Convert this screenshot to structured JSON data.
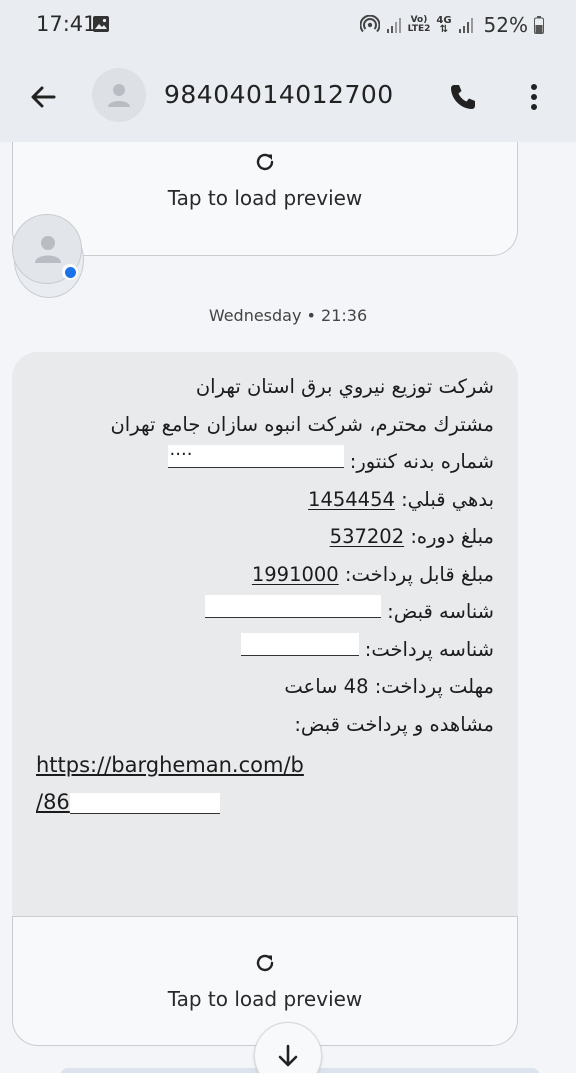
{
  "status_bar": {
    "time": "17:41",
    "network_top": "Vo)",
    "network_bottom": "LTE2",
    "network_4g": "4G",
    "battery": "52%"
  },
  "top_bar": {
    "contact_number": "98404014012700"
  },
  "preview_top": {
    "label": "Tap to load preview"
  },
  "timestamp": "Wednesday • 21:36",
  "message": {
    "line1": "شرکت توزیع نیروي برق استان تهران",
    "line2": "مشترك محترم، شرکت انبوه سازان جامع تهران",
    "meter_label": "شماره بدنه کنتور:",
    "meter_value": "....",
    "previous_debt_label": "بدهي قبلي:",
    "previous_debt_value": "1454454",
    "period_amount_label": "مبلغ دوره:",
    "period_amount_value": "537202",
    "payable_label": "مبلغ قابل پرداخت:",
    "payable_value": "1991000",
    "bill_id_label": "شناسه قبض:",
    "payment_id_label": "شناسه پرداخت:",
    "deadline_label": "مهلت پرداخت:",
    "deadline_value": "48 ساعت",
    "view_pay_label": "مشاهده و پرداخت قبض:",
    "link_line1": "https://bargheman.com/b",
    "link_line2": "/86"
  },
  "preview_bottom": {
    "label": "Tap to load preview"
  },
  "icons": {
    "back": "arrow-left-icon",
    "call": "phone-icon",
    "more": "more-vert-icon",
    "reload": "refresh-icon",
    "scroll": "arrow-down-icon"
  }
}
